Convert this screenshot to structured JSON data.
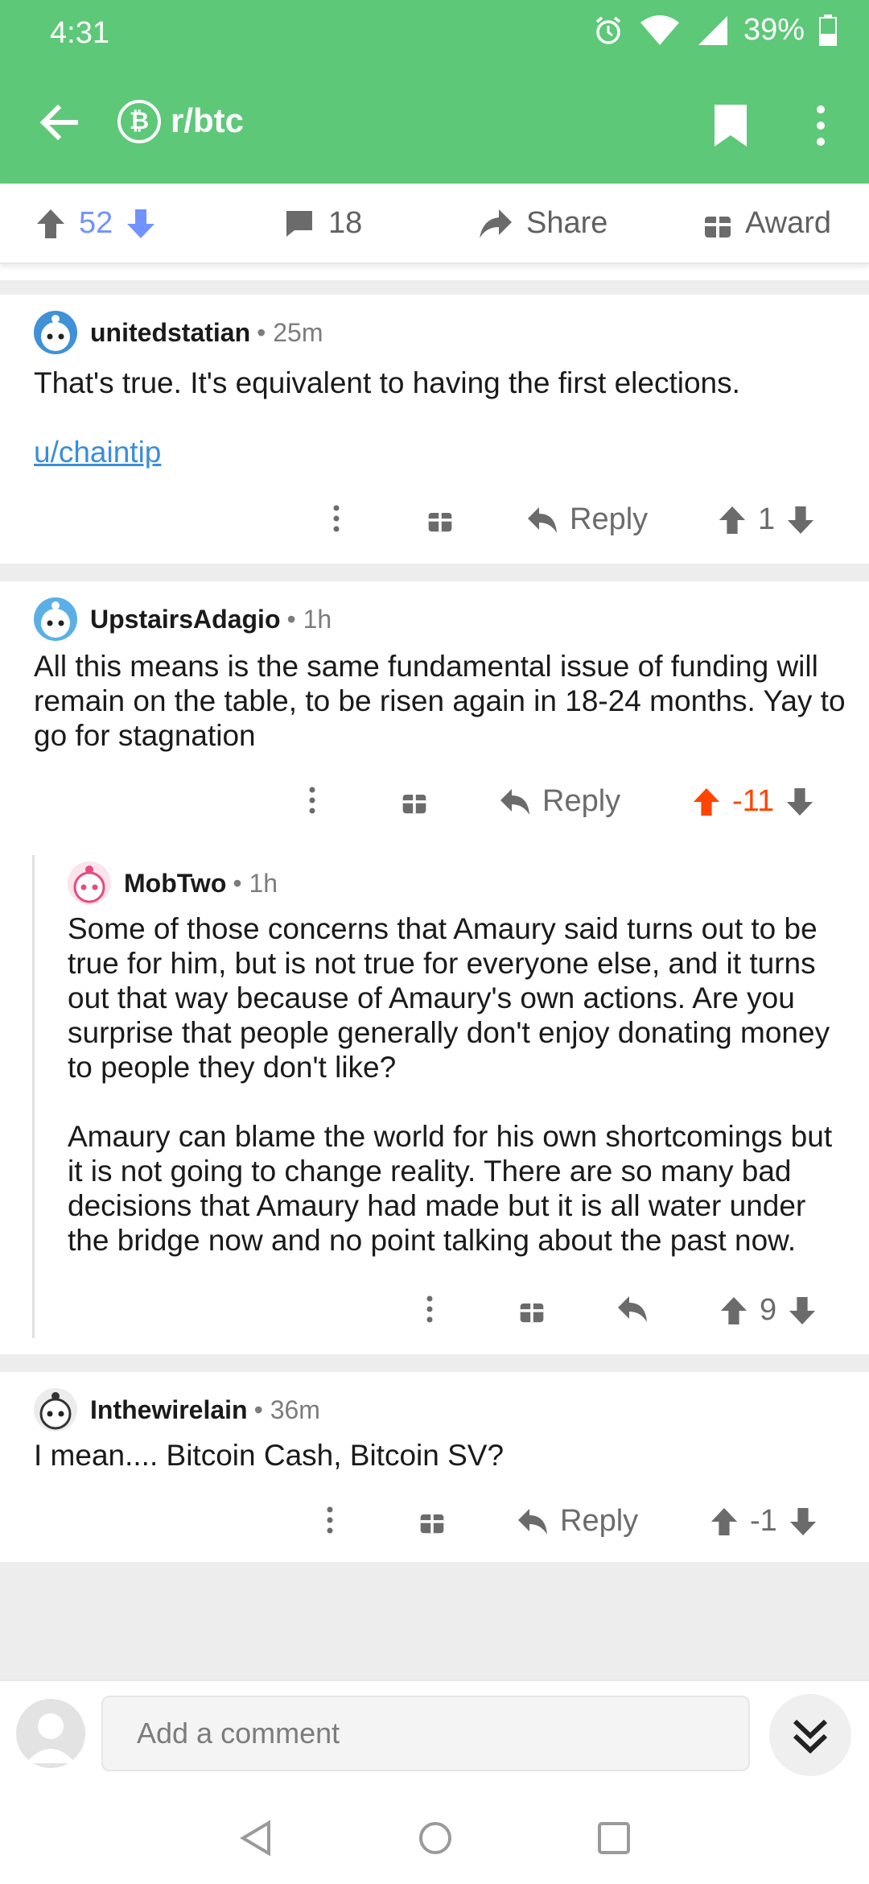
{
  "status_bar": {
    "time": "4:31",
    "battery": "39%"
  },
  "header": {
    "subreddit": "r/btc",
    "sub_icon_glyph": "₿"
  },
  "post_bar": {
    "upvotes": "52",
    "comments": "18",
    "share_label": "Share",
    "award_label": "Award"
  },
  "comments": [
    {
      "user": "unitedstatian",
      "age": "25m",
      "text": "That's true. It's equivalent to having the first elections.",
      "link": "u/chaintip",
      "reply_label": "Reply",
      "score": "1"
    },
    {
      "user": "UpstairsAdagio",
      "age": "1h",
      "text": "All this means is the same fundamental issue of funding will remain on the table, to be risen again in 18-24 months. Yay to go for stagnation",
      "reply_label": "Reply",
      "score": "-11"
    },
    {
      "user": "MobTwo",
      "age": "1h",
      "text_p1": "Some of those concerns that Amaury said turns out to be true for him, but is not true for everyone else, and it turns out that way because of Amaury's own actions. Are you surprise that people generally don't enjoy donating money to people they don't like?",
      "text_p2": "Amaury can blame the world for his own shortcomings but it is not going to change reality. There are so many bad decisions that Amaury had made but it is all water under the bridge now and no point talking about the past now.",
      "score": "9"
    },
    {
      "user": "Inthewirelain",
      "age": "36m",
      "text": "I mean.... Bitcoin Cash, Bitcoin SV?",
      "reply_label": "Reply",
      "score": "-1"
    }
  ],
  "bottom": {
    "placeholder": "Add a comment"
  },
  "colors": {
    "header_green": "#5ec879",
    "upvote_blue": "#7193ff",
    "downvote_red": "#ff4500",
    "link_blue": "#3a8ed8"
  },
  "icons": [
    "back-arrow-icon",
    "bitcoin-icon",
    "bookmark-icon",
    "overflow-menu-icon",
    "upvote-icon",
    "downvote-icon",
    "comment-icon",
    "share-icon",
    "award-icon",
    "reply-icon",
    "more-icon",
    "alarm-icon",
    "wifi-icon",
    "signal-icon",
    "battery-icon",
    "chevron-double-down-icon"
  ]
}
